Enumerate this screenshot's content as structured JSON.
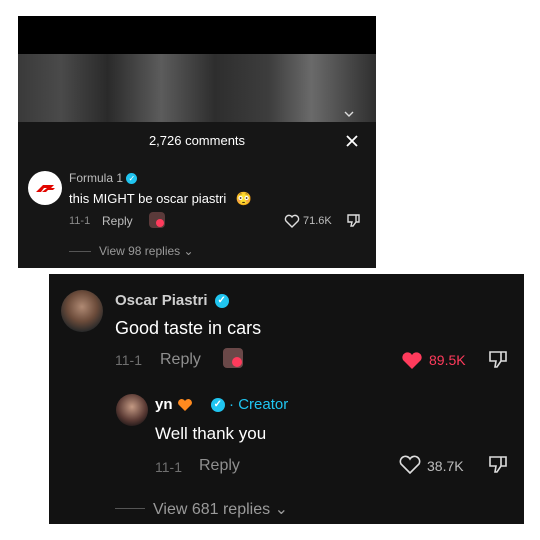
{
  "top": {
    "comments_count": "2,726 comments",
    "comment": {
      "author": "Formula 1",
      "text": "this MIGHT be  oscar piastri",
      "emoji": "😳",
      "date": "11-1",
      "reply": "Reply",
      "likes": "71.6K",
      "view_replies": "View 98 replies"
    }
  },
  "bottom": {
    "comment": {
      "author": "Oscar Piastri",
      "text": "Good taste in cars",
      "date": "11-1",
      "reply": "Reply",
      "likes": "89.5K",
      "like_color": "#ff3b5c"
    },
    "reply": {
      "author": "yn",
      "creator_label": "Creator",
      "text": "Well thank you",
      "date": "11-1",
      "reply": "Reply",
      "likes": "38.7K"
    },
    "view_replies": "View 681 replies"
  },
  "colors": {
    "verified": "#20c5f0",
    "f1_red": "#e10600",
    "heart_orange": "#ff8a1f"
  }
}
